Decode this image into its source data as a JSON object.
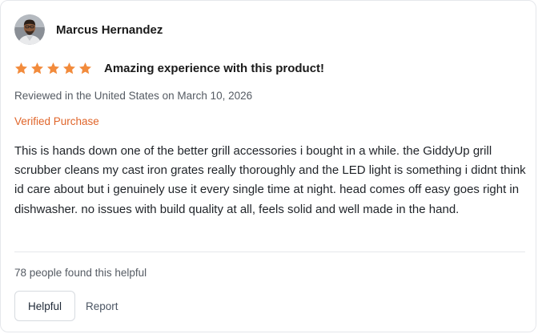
{
  "review": {
    "reviewer_name": "Marcus Hernandez",
    "rating": 5,
    "rating_max": 5,
    "title": "Amazing experience with this product!",
    "meta": "Reviewed in the United States on March 10, 2026",
    "verified_label": "Verified Purchase",
    "body": "This is hands down one of the better grill accessories i bought in a while. the GiddyUp grill scrubber cleans my cast iron grates really thoroughly and the LED light is something i didnt think id care about but i genuinely use it every single time at night. head comes off easy goes right in dishwasher. no issues with build quality at all, feels solid and well made in the hand.",
    "helpful_count_text": "78 people found this helpful"
  },
  "actions": {
    "helpful_label": "Helpful",
    "report_label": "Report"
  },
  "icons": {
    "star": "star-icon",
    "avatar": "avatar"
  },
  "colors": {
    "star": "#f28b3c",
    "verified": "#e0652a",
    "border": "#e5e7eb"
  }
}
